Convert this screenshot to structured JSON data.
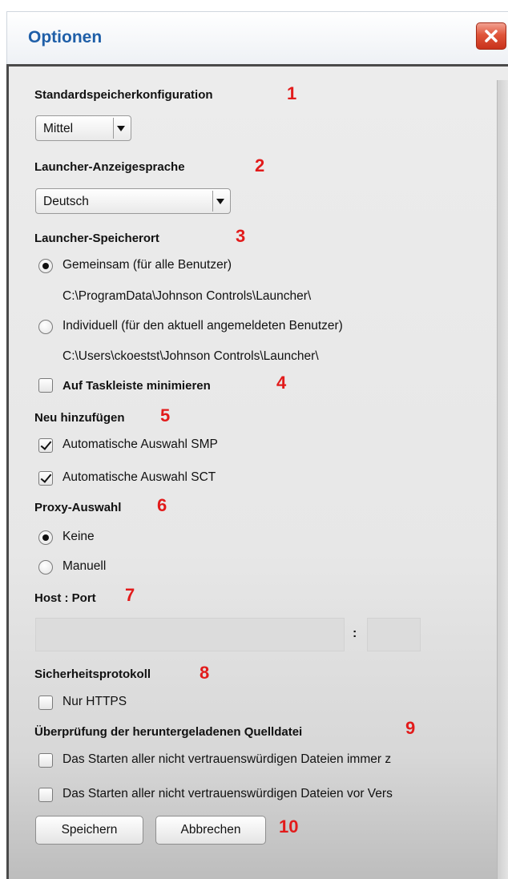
{
  "window": {
    "title": "Optionen"
  },
  "sections": {
    "memory": {
      "heading": "Standardspeicherkonfiguration",
      "number": "1",
      "selected": "Mittel"
    },
    "language": {
      "heading": "Launcher-Anzeigesprache",
      "number": "2",
      "selected": "Deutsch"
    },
    "location": {
      "heading": "Launcher-Speicherort",
      "number": "3",
      "options": [
        {
          "label": "Gemeinsam (für alle Benutzer)",
          "path": "C:\\ProgramData\\Johnson Controls\\Launcher\\",
          "selected": true
        },
        {
          "label": "Individuell (für den aktuell angemeldeten Benutzer)",
          "path": "C:\\Users\\ckoestst\\Johnson Controls\\Launcher\\",
          "selected": false
        }
      ]
    },
    "taskbar": {
      "label": "Auf Taskleiste minimieren",
      "number": "4",
      "checked": false
    },
    "add_new": {
      "heading": "Neu hinzufügen",
      "number": "5",
      "options": [
        {
          "label": "Automatische Auswahl SMP",
          "checked": true
        },
        {
          "label": "Automatische Auswahl SCT",
          "checked": true
        }
      ]
    },
    "proxy": {
      "heading": "Proxy-Auswahl",
      "number": "6",
      "options": [
        {
          "label": "Keine",
          "selected": true
        },
        {
          "label": "Manuell",
          "selected": false
        }
      ]
    },
    "host_port": {
      "heading": "Host : Port",
      "number": "7",
      "separator": ":",
      "host_value": "",
      "port_value": ""
    },
    "security": {
      "heading": "Sicherheitsprotokoll",
      "number": "8",
      "option": {
        "label": "Nur HTTPS",
        "checked": false
      }
    },
    "verification": {
      "heading": "Überprüfung der heruntergeladenen Quelldatei",
      "number": "9",
      "options": [
        {
          "label": "Das Starten aller nicht vertrauenswürdigen Dateien immer z",
          "checked": false
        },
        {
          "label": "Das Starten aller nicht vertrauenswürdigen Dateien vor Vers",
          "checked": false
        }
      ]
    }
  },
  "buttons": {
    "save": "Speichern",
    "cancel": "Abbrechen",
    "number": "10"
  },
  "icons": {
    "close": "close-icon",
    "dropdown": "chevron-down-icon"
  },
  "colors": {
    "title": "#1f5fa8",
    "annotation": "#e21b1b",
    "close_button": "#e0553a"
  }
}
